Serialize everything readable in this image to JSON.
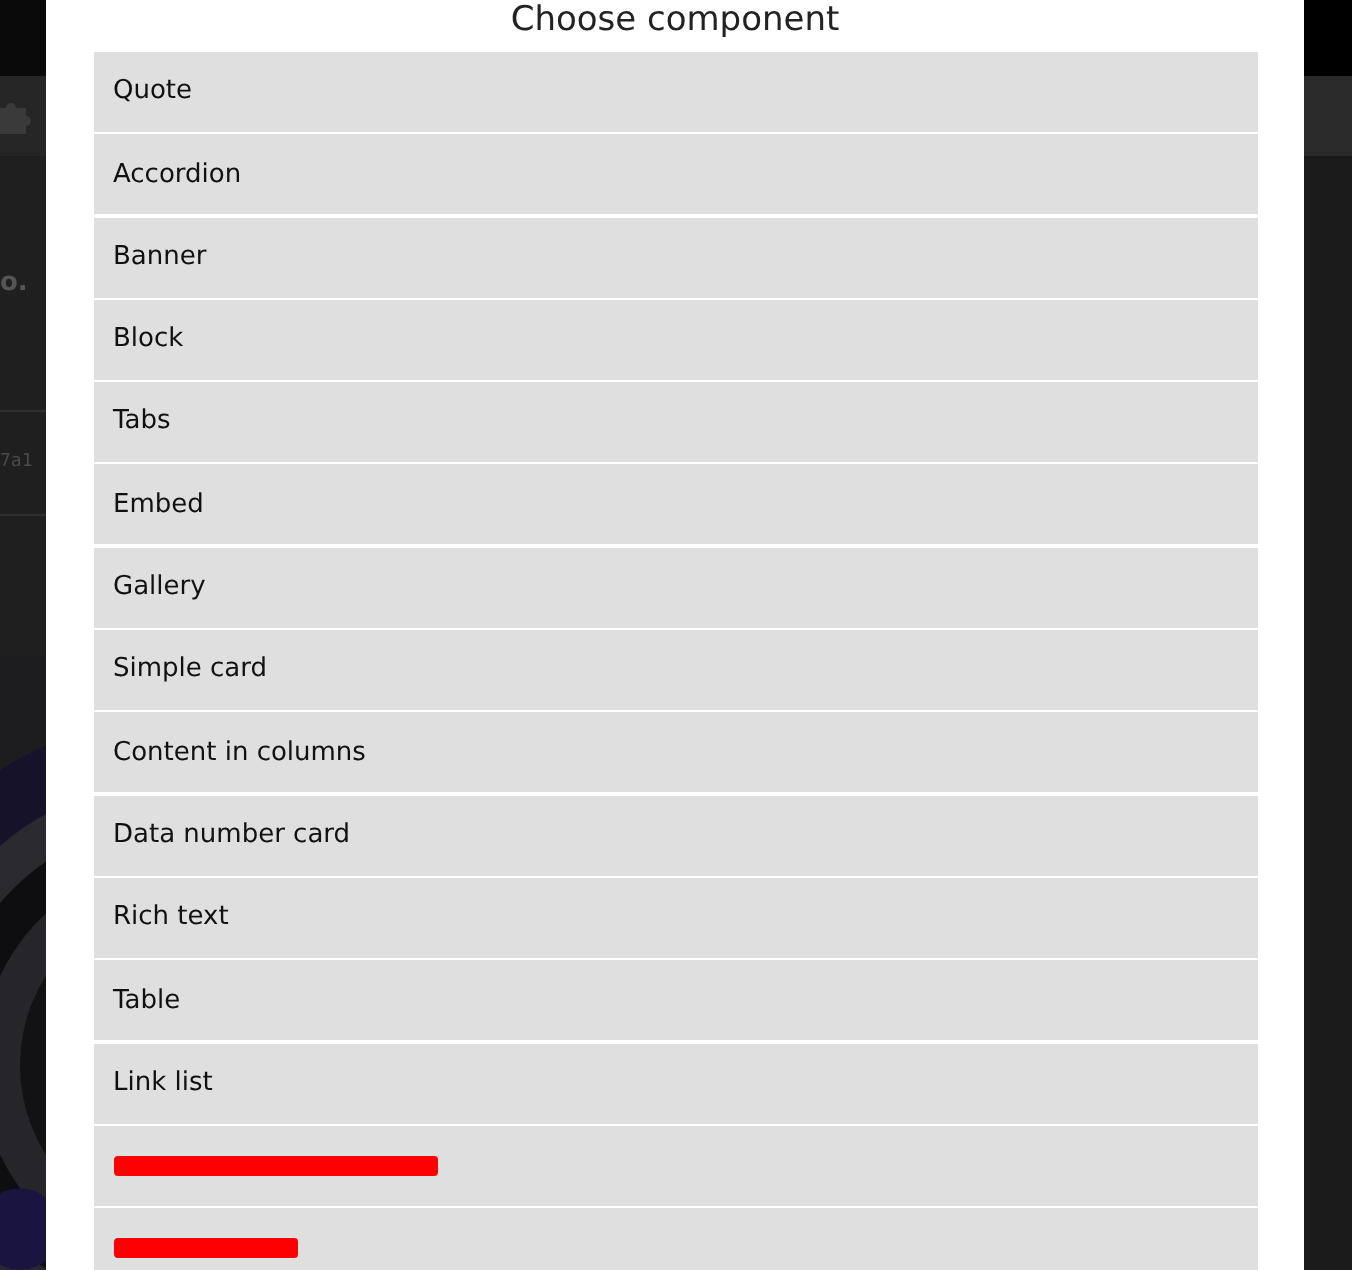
{
  "background": {
    "heading_fragment": "o.",
    "code_fragment": "7a1"
  },
  "dialog": {
    "title": "Choose component",
    "items": [
      {
        "kind": "text",
        "label": "Quote"
      },
      {
        "kind": "text",
        "label": "Accordion"
      },
      {
        "kind": "text",
        "label": "Banner"
      },
      {
        "kind": "text",
        "label": "Block"
      },
      {
        "kind": "text",
        "label": "Tabs"
      },
      {
        "kind": "text",
        "label": "Embed"
      },
      {
        "kind": "text",
        "label": "Gallery"
      },
      {
        "kind": "text",
        "label": "Simple card"
      },
      {
        "kind": "text",
        "label": "Content in columns"
      },
      {
        "kind": "text",
        "label": "Data number card"
      },
      {
        "kind": "text",
        "label": "Rich text"
      },
      {
        "kind": "text",
        "label": "Table"
      },
      {
        "kind": "text",
        "label": "Link list"
      },
      {
        "kind": "redacted"
      },
      {
        "kind": "redacted"
      }
    ]
  }
}
